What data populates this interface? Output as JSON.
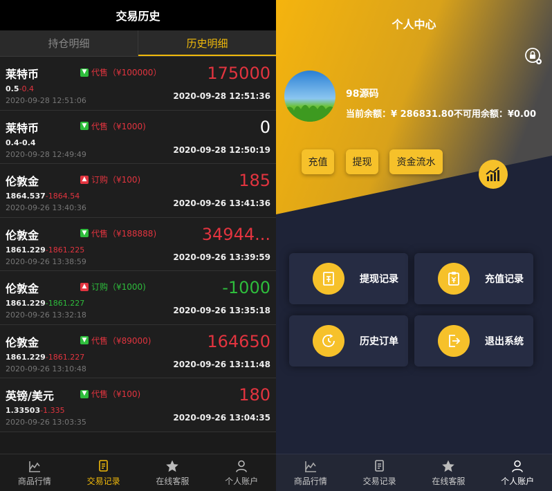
{
  "left": {
    "title": "交易历史",
    "tabs": [
      "持仓明细",
      "历史明细"
    ],
    "trades": [
      {
        "name": "莱特币",
        "dir": "down",
        "badge": "代售（¥100000）",
        "profit": "175000",
        "profit_color": "red",
        "open_price": "0.5",
        "close_price": "-0.4",
        "price_color": "red",
        "open_time": "2020-09-28 12:51:06",
        "close_time": "2020-09-28 12:51:36"
      },
      {
        "name": "莱特币",
        "dir": "down",
        "badge": "代售（¥1000)",
        "profit": "0",
        "profit_color": "white",
        "open_price": "0.4-0.4",
        "close_price": "",
        "price_color": "white",
        "open_time": "2020-09-28 12:49:49",
        "close_time": "2020-09-28 12:50:19"
      },
      {
        "name": "伦敦金",
        "dir": "up",
        "badge": "订购（¥100)",
        "profit": "185",
        "profit_color": "red",
        "open_price": "1864.537",
        "close_price": "-1864.54",
        "price_color": "red",
        "open_time": "2020-09-26 13:40:36",
        "close_time": "2020-09-26 13:41:36"
      },
      {
        "name": "伦敦金",
        "dir": "down",
        "badge": "代售（¥188888)",
        "profit": "34944...",
        "profit_color": "red",
        "open_price": "1861.229",
        "close_price": "-1861.225",
        "price_color": "red",
        "open_time": "2020-09-26 13:38:59",
        "close_time": "2020-09-26 13:39:59"
      },
      {
        "name": "伦敦金",
        "dir": "up",
        "badge": "订购（¥1000)",
        "profit": "-1000",
        "profit_color": "green",
        "open_price": "1861.229",
        "close_price": "-1861.227",
        "price_color": "green",
        "open_time": "2020-09-26 13:32:18",
        "close_time": "2020-09-26 13:35:18"
      },
      {
        "name": "伦敦金",
        "dir": "down",
        "badge": "代售（¥89000)",
        "profit": "164650",
        "profit_color": "red",
        "open_price": "1861.229",
        "close_price": "-1861.227",
        "price_color": "red",
        "open_time": "2020-09-26 13:10:48",
        "close_time": "2020-09-26 13:11:48"
      },
      {
        "name": "英镑/美元",
        "dir": "down",
        "badge": "代售（¥100)",
        "profit": "180",
        "profit_color": "red",
        "open_price": "1.33503",
        "close_price": "-1.335",
        "price_color": "red",
        "open_time": "2020-09-26 13:03:35",
        "close_time": "2020-09-26 13:04:35"
      }
    ],
    "nav": [
      "商品行情",
      "交易记录",
      "在线客服",
      "个人账户"
    ]
  },
  "right": {
    "title": "个人中心",
    "username": "98源码",
    "balance_line": "当前余额：¥ 286831.80不可用余额：¥0.00",
    "buttons": [
      "充值",
      "提现",
      "资金流水"
    ],
    "cards": [
      "提现记录",
      "充值记录",
      "历史订单",
      "退出系统"
    ],
    "nav": [
      "商品行情",
      "交易记录",
      "在线客服",
      "个人账户"
    ],
    "colors": {
      "accent": "#f6c12a",
      "panel_bg": "#1e2337"
    }
  }
}
